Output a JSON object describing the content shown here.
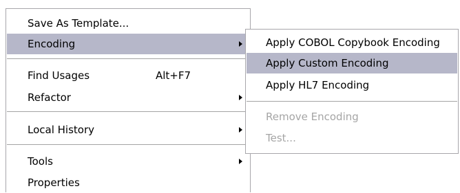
{
  "context_menu": {
    "items": [
      {
        "label": "Save As Template..."
      },
      {
        "label": "Encoding"
      },
      {
        "label": "Find Usages",
        "shortcut": "Alt+F7"
      },
      {
        "label": "Refactor"
      },
      {
        "label": "Local History"
      },
      {
        "label": "Tools"
      },
      {
        "label": "Properties"
      }
    ]
  },
  "encoding_submenu": {
    "items": [
      {
        "label": "Apply COBOL Copybook Encoding"
      },
      {
        "label": "Apply Custom Encoding"
      },
      {
        "label": "Apply HL7 Encoding"
      },
      {
        "label": "Remove Encoding"
      },
      {
        "label": "Test..."
      }
    ]
  },
  "colors": {
    "highlight": "#b6b7c9",
    "disabled_text": "#a5a5a5",
    "border": "#a7a6aa"
  }
}
